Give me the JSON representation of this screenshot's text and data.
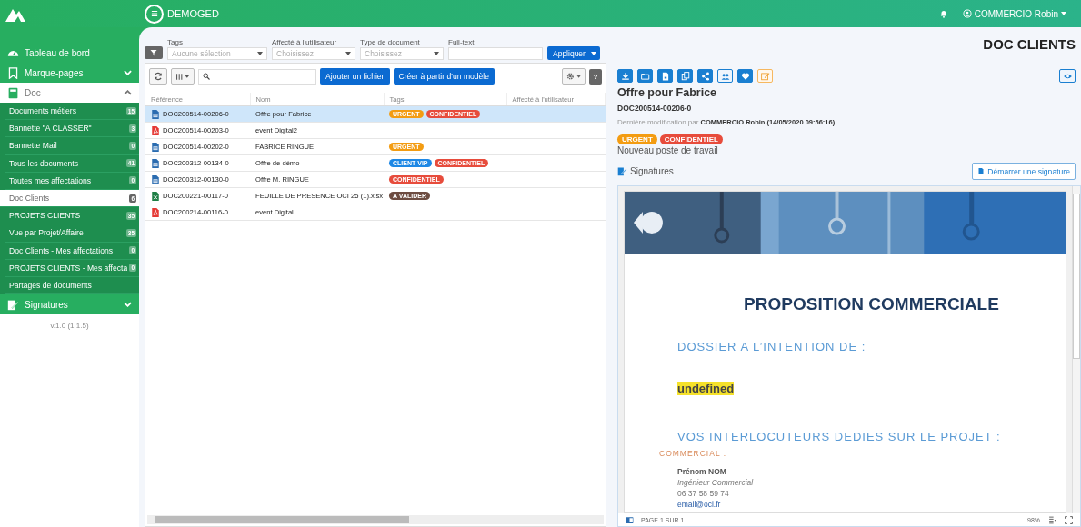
{
  "header": {
    "app_name": "DEMOGED",
    "user": "COMMERCIO Robin"
  },
  "sidebar": {
    "items": [
      {
        "label": "Tableau de bord",
        "kind": "link"
      },
      {
        "label": "Marque-pages",
        "kind": "group",
        "expanded": false
      },
      {
        "label": "Doc",
        "kind": "group",
        "expanded": true,
        "children": [
          {
            "label": "Documents métiers",
            "count": "15",
            "selected": false
          },
          {
            "label": "Bannette \"A CLASSER\"",
            "count": "3",
            "selected": false
          },
          {
            "label": "Bannette Mail",
            "count": "0",
            "selected": false
          },
          {
            "label": "Tous les documents",
            "count": "41",
            "selected": false
          },
          {
            "label": "Toutes mes affectations",
            "count": "0",
            "selected": false
          },
          {
            "label": "Doc Clients",
            "count": "6",
            "selected": true
          },
          {
            "label": "PROJETS CLIENTS",
            "count": "35",
            "selected": false
          },
          {
            "label": "Vue par Projet/Affaire",
            "count": "35",
            "selected": false
          },
          {
            "label": "Doc Clients - Mes affectations",
            "count": "0",
            "selected": false
          },
          {
            "label": "PROJETS CLIENTS - Mes affecta",
            "count": "0",
            "selected": false
          },
          {
            "label": "Partages de documents",
            "selected": false
          }
        ]
      },
      {
        "label": "Signatures",
        "kind": "group",
        "expanded": false
      }
    ],
    "version": "v.1.0 (1.1.5)"
  },
  "filters": {
    "fields": [
      {
        "label": "Tags",
        "placeholder": "Aucune sélection"
      },
      {
        "label": "Affecté à l'utilisateur",
        "placeholder": "Choisissez"
      },
      {
        "label": "Type de document",
        "placeholder": "Choisissez"
      },
      {
        "label": "Full-text",
        "kind": "text"
      }
    ],
    "apply_button": "Appliquer"
  },
  "toolbar": {
    "buttons": [
      "Ajouter un fichier",
      "Créer à partir d'un modèle"
    ],
    "help": "?"
  },
  "table": {
    "columns": [
      "Référence",
      "Nom",
      "Tags",
      "Affecté à l'utilisateur"
    ],
    "rows": [
      {
        "reference": "DOC200514-00206-0",
        "name": "Offre pour Fabrice",
        "kind": "word",
        "selected": true,
        "tags": [
          {
            "label": "URGENT",
            "color": "#f39c12"
          },
          {
            "label": "CONFIDENTIEL",
            "color": "#e74c3c"
          }
        ]
      },
      {
        "reference": "DOC200514-00203-0",
        "name": "event Digital2",
        "kind": "pdf",
        "selected": false,
        "tags": []
      },
      {
        "reference": "DOC200514-00202-0",
        "name": "FABRICE RINGUE",
        "kind": "word",
        "selected": false,
        "tags": [
          {
            "label": "URGENT",
            "color": "#f39c12"
          }
        ]
      },
      {
        "reference": "DOC200312-00134-0",
        "name": "Offre de démo",
        "kind": "word",
        "selected": false,
        "tags": [
          {
            "label": "CLIENT VIP",
            "color": "#1e88e5"
          },
          {
            "label": "CONFIDENTIEL",
            "color": "#e74c3c"
          }
        ]
      },
      {
        "reference": "DOC200312-00130-0",
        "name": "Offre M. RINGUE",
        "kind": "word",
        "selected": false,
        "tags": [
          {
            "label": "CONFIDENTIEL",
            "color": "#e74c3c"
          }
        ]
      },
      {
        "reference": "DOC200221-00117-0",
        "name": "FEUILLE DE PRESENCE OCI 25 (1).xlsx",
        "kind": "excel",
        "selected": false,
        "tags": [
          {
            "label": "A VALIDER",
            "color": "#6d4c41"
          }
        ]
      },
      {
        "reference": "DOC200214-00116-0",
        "name": "event Digital",
        "kind": "pdf",
        "selected": false,
        "tags": []
      }
    ]
  },
  "detail": {
    "page_title": "DOC CLIENTS",
    "actions": [
      {
        "kind": "download"
      },
      {
        "kind": "folder"
      },
      {
        "kind": "file"
      },
      {
        "kind": "copy"
      },
      {
        "kind": "share"
      },
      {
        "kind": "users"
      },
      {
        "kind": "heart"
      },
      {
        "kind": "edit"
      }
    ],
    "title": "Offre pour Fabrice",
    "reference": "DOC200514-00206-0",
    "modified": "Dernière modification par **COMMERCIO Robin (14/05/2020 09:56:16)**",
    "tags": [
      {
        "label": "URGENT",
        "color": "#f39c12"
      },
      {
        "label": "CONFIDENTIEL",
        "color": "#e74c3c"
      }
    ],
    "description": "Nouveau poste de travail",
    "signatures_label": "Signatures",
    "signature_button": "Démarrer une signature"
  },
  "preview": {
    "heading": "PROPOSITION COMMERCIALE",
    "intro": "DOSSIER A L’INTENTION DE :",
    "recipient": "undefined",
    "contacts_heading": "VOS INTERLOCUTEURS DEDIES SUR LE PROJET :",
    "role": "COMMERCIAL :",
    "contact": {
      "name": "Prénom NOM",
      "title": "Ingénieur Commercial",
      "phone": "06 37 58 59 74",
      "email": "email@oci.fr"
    },
    "page": "PAGE 1 SUR 1",
    "zoom": "98%"
  }
}
